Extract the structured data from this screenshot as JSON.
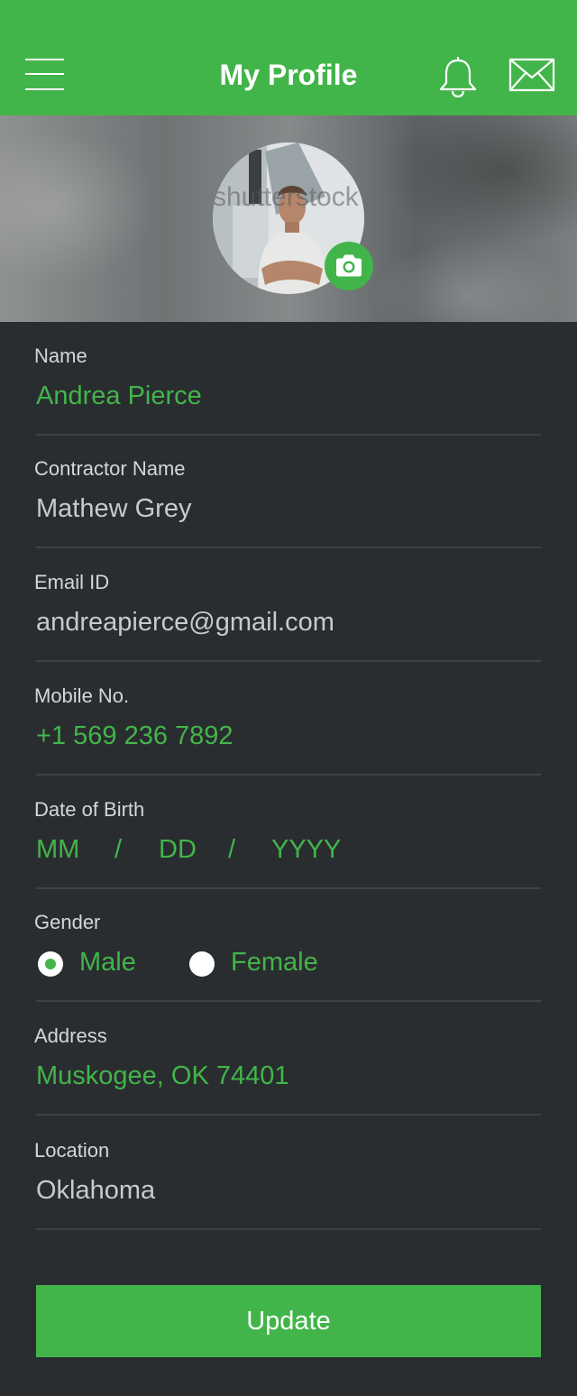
{
  "header": {
    "title": "My Profile",
    "menu_icon": "hamburger-menu-icon",
    "notification_icon": "bell-icon",
    "message_icon": "mail-icon",
    "background_color": "#42b54a"
  },
  "profile": {
    "photo_alt": "profile-photo",
    "camera_icon": "camera-icon",
    "watermark": "shutterstock"
  },
  "fields": {
    "name": {
      "label": "Name",
      "value": "Andrea Pierce"
    },
    "contractor_name": {
      "label": "Contractor Name",
      "value": "Mathew Grey"
    },
    "email": {
      "label": "Email ID",
      "value": "andreapierce@gmail.com"
    },
    "mobile": {
      "label": "Mobile No.",
      "value": "+1 569 236 7892"
    },
    "dob": {
      "label": "Date of Birth",
      "month_placeholder": "MM",
      "separator": "/",
      "day_placeholder": "DD",
      "year_placeholder": "YYYY"
    },
    "gender": {
      "label": "Gender",
      "options": [
        "Male",
        "Female"
      ],
      "selected": "Male"
    },
    "address": {
      "label": "Address",
      "value": "Muskogee, OK 74401"
    },
    "location": {
      "label": "Location",
      "value": "Oklahoma"
    }
  },
  "actions": {
    "update_label": "Update"
  },
  "colors": {
    "accent": "#42b54a",
    "background": "#2a2d30",
    "divider": "#3e4245"
  }
}
